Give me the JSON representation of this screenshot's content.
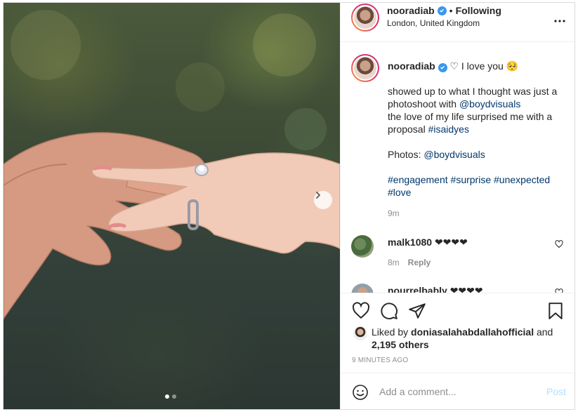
{
  "post": {
    "username": "nooradiab",
    "separator": "•",
    "following_label": "Following",
    "location": "London, United Kingdom"
  },
  "caption": {
    "username": "nooradiab",
    "heading": "♡ I love you 🥺",
    "line1_pre": "showed up to what I thought was just a photoshoot with ",
    "line1_mention": "@boydvisuals",
    "line2_pre": "the love of my life surprised me with a proposal ",
    "line2_tag": "#isaidyes",
    "photos_label": "Photos: ",
    "photos_mention": "@boydvisuals",
    "hashtags": [
      "#engagement",
      "#surprise",
      "#unexpected",
      "#love"
    ],
    "time": "9m"
  },
  "comments": [
    {
      "username": "malk1080",
      "text": "❤❤❤❤",
      "time": "8m",
      "reply_label": "Reply"
    },
    {
      "username": "nourrelbably",
      "text": "❤❤❤❤"
    }
  ],
  "likes": {
    "prefix": "Liked by ",
    "user": "doniasalahabdallahofficial",
    "connector": " and",
    "others": "2,195 others"
  },
  "timestamp": "9 MINUTES AGO",
  "comment_box": {
    "placeholder": "Add a comment...",
    "post_label": "Post"
  },
  "carousel": {
    "total": 2,
    "active": 1
  },
  "colors": {
    "link": "#00376b",
    "verified": "#3897f0",
    "post_disabled": "#b2dffc",
    "muted": "#8e8e8e"
  }
}
